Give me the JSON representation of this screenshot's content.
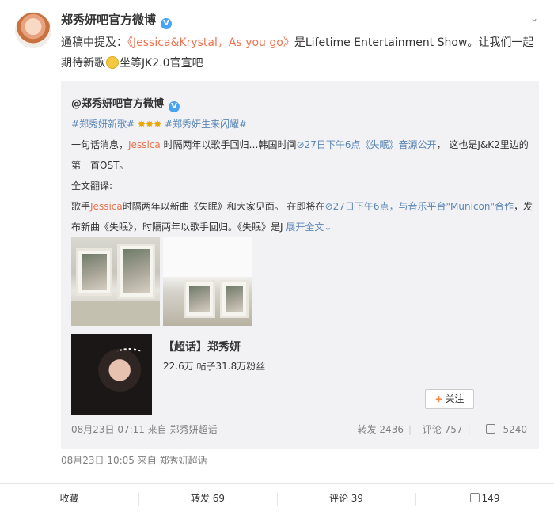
{
  "post": {
    "username": "郑秀妍吧官方微博",
    "verified_badge": "V",
    "text_prefix": "通稿中提及：",
    "text_link": "《Jessica&Krystal，As you go》",
    "text_rest": "是Lifetime Entertainment Show。让我们一起期待新歌",
    "text_end": "坐等JK2.0官宣吧",
    "time_source": "08月23日 10:05  来自 郑秀妍超话"
  },
  "repost": {
    "username": "@郑秀妍吧官方微博",
    "hashtag1": "#郑秀妍新歌#",
    "hashtag2": "#郑秀妍生来闪耀#",
    "line1_a": "一句话消息，",
    "line1_name": "Jessica",
    "line1_b": " 时隔两年以歌手回归…韩国时间",
    "line1_link": "27日下午6点《失眠》音源公开",
    "line1_c": "， 这也是J&K2里边的第一首OST。",
    "translation_label": "全文翻译:",
    "line3_a": "歌手",
    "line3_name": "Jessica",
    "line3_b": "时隔两年以新曲《失眠》和大家见面。 在即将在",
    "line3_link": "27日下午6点，与音乐平台\"Municon\"合作",
    "line3_c": "，发布新曲《失眠》，时隔两年以歌手回归。《失眠》是J ",
    "expand_label": "展开全文",
    "topic_title": "【超话】郑秀妍",
    "topic_stats": "22.6万 帖子31.8万粉丝",
    "follow_label": "关注",
    "time_source": "08月23日 07:11  来自 郑秀妍超话",
    "reposts": "转发 2436",
    "comments": "评论 757",
    "likes": "5240"
  },
  "actions": {
    "collect": "收藏",
    "repost": "转发 69",
    "comment": "评论 39",
    "like": "149"
  },
  "colors": {
    "link_orange": "#eb7350",
    "link_blue": "#5b86b5",
    "repost_bg": "#f2f2f5"
  }
}
